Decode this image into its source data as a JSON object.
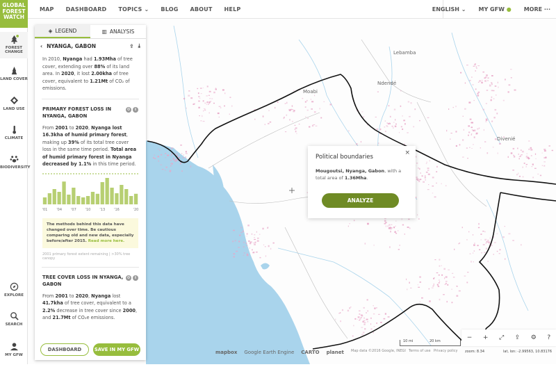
{
  "logo": {
    "line1": "GLOBAL",
    "line2": "FOREST",
    "line3": "WATCH",
    "color": "#97bd3d"
  },
  "nav": {
    "left": [
      "MAP",
      "DASHBOARD",
      "TOPICS",
      "BLOG",
      "ABOUT",
      "HELP"
    ],
    "language": "ENGLISH",
    "mygfw": "MY GFW",
    "more": "MORE"
  },
  "sidebar": {
    "top": [
      {
        "label": "FOREST CHANGE",
        "icon": "tree-icon",
        "badge": "1"
      },
      {
        "label": "LAND COVER",
        "icon": "land-cover-icon"
      },
      {
        "label": "LAND USE",
        "icon": "land-use-icon"
      },
      {
        "label": "CLIMATE",
        "icon": "thermometer-icon"
      },
      {
        "label": "BIODIVERSITY",
        "icon": "paw-icon"
      }
    ],
    "bottom": [
      {
        "label": "EXPLORE",
        "icon": "compass-icon"
      },
      {
        "label": "SEARCH",
        "icon": "search-icon"
      },
      {
        "label": "MY GFW",
        "icon": "user-icon"
      }
    ]
  },
  "panel": {
    "tabs": {
      "legend": "LEGEND",
      "analysis": "ANALYSIS"
    },
    "title": "NYANGA, GABON",
    "summary": {
      "p1": "In 2010, ",
      "name": "Nyanga",
      "p2": " had ",
      "cover": "1.93Mha",
      "p3": " of tree cover, extending over ",
      "pct": "88%",
      "p4": " of its land area. In ",
      "year": "2020",
      "p5": ", it lost ",
      "lost": "2.00kha",
      "p6": " of tree cover, equivalent to ",
      "co2": "1.21Mt",
      "p7": " of CO₂ of emissions."
    },
    "primary": {
      "title": "PRIMARY FOREST LOSS IN NYANGA, GABON",
      "t1": "From ",
      "from": "2001",
      "t2": " to ",
      "to": "2020",
      "t3": ", ",
      "name": "Nyanga",
      "t4": " lost 16.3kha of humid primary forest",
      "t5": ", making up ",
      "pct": "39%",
      "t6": " of its total tree cover loss in the same time period. ",
      "t7": "Total area of humid primary forest in Nyanga decreased by 1.1%",
      "t8": " in this time period."
    },
    "chart_years": [
      "'01",
      "'04",
      "'07",
      "'10",
      "'13",
      "'16",
      "'20"
    ],
    "note": {
      "text": "The methods behind this data have changed over time. Be cautious comparing old and new data, especially before/after 2015. ",
      "link": "Read more here."
    },
    "small_note": "2001 primary forest extent remaining | >30% tree canopy",
    "treecover": {
      "title": "TREE COVER LOSS IN NYANGA, GABON",
      "t1": "From ",
      "from": "2001",
      "t2": " to ",
      "to": "2020",
      "t3": ", ",
      "name": "Nyanga",
      "t4": " lost ",
      "lost": "41.7kha",
      "t5": " of tree cover, equivalent to a ",
      "pct": "2.2%",
      "t6": " decrease in tree cover since ",
      "since": "2000",
      "t7": ", and ",
      "co2": "21.7Mt",
      "t8": " of CO₂e emissions."
    },
    "buttons": {
      "dashboard": "DASHBOARD",
      "save": "SAVE IN MY GFW"
    }
  },
  "chart_data": {
    "type": "bar",
    "categories": [
      "2001",
      "2002",
      "2003",
      "2004",
      "2005",
      "2006",
      "2007",
      "2008",
      "2009",
      "2010",
      "2011",
      "2012",
      "2013",
      "2014",
      "2015",
      "2016",
      "2017",
      "2018",
      "2019",
      "2020"
    ],
    "values": [
      0.25,
      0.4,
      0.55,
      0.45,
      0.82,
      0.35,
      0.6,
      0.3,
      0.25,
      0.3,
      0.45,
      0.38,
      0.8,
      0.95,
      0.6,
      0.4,
      0.7,
      0.55,
      0.3,
      0.38
    ],
    "bar_color": "#b7cf72",
    "dashed_line_color": "#97bd3d",
    "xlabel": "",
    "ylabel": ""
  },
  "popup": {
    "title": "Political boundaries",
    "close": "×",
    "place": "Mougoutsi, Nyanga, Gabon",
    "t1": ", with a total area of ",
    "area": "1.36Mha",
    "t2": ".",
    "button": "ANALYZE"
  },
  "map": {
    "labels": [
      {
        "text": "Lebamba",
        "name": "map-label-lebamba"
      },
      {
        "text": "Ndendé",
        "name": "map-label-ndende"
      },
      {
        "text": "Moabi",
        "name": "map-label-moabi"
      },
      {
        "text": "Divenié",
        "name": "map-label-divenie"
      }
    ],
    "scale_mi": "10 mi",
    "scale_km": "20 km",
    "zoom": "zoom: 8.34",
    "latlon": "lat, lon: -2.99563, 10.83176",
    "attribution": [
      "Map data ©2016 Google, INEGI",
      "Terms of use",
      "Privacy policy"
    ],
    "logos": [
      "mapbox",
      "Google Earth Engine",
      "CARTO",
      "planet"
    ],
    "water_color": "#a9d4ec",
    "loss_color": "#e8a6c7"
  },
  "toolbar": [
    "−",
    "+",
    "⤢",
    "⇪",
    "⚙",
    "?"
  ]
}
